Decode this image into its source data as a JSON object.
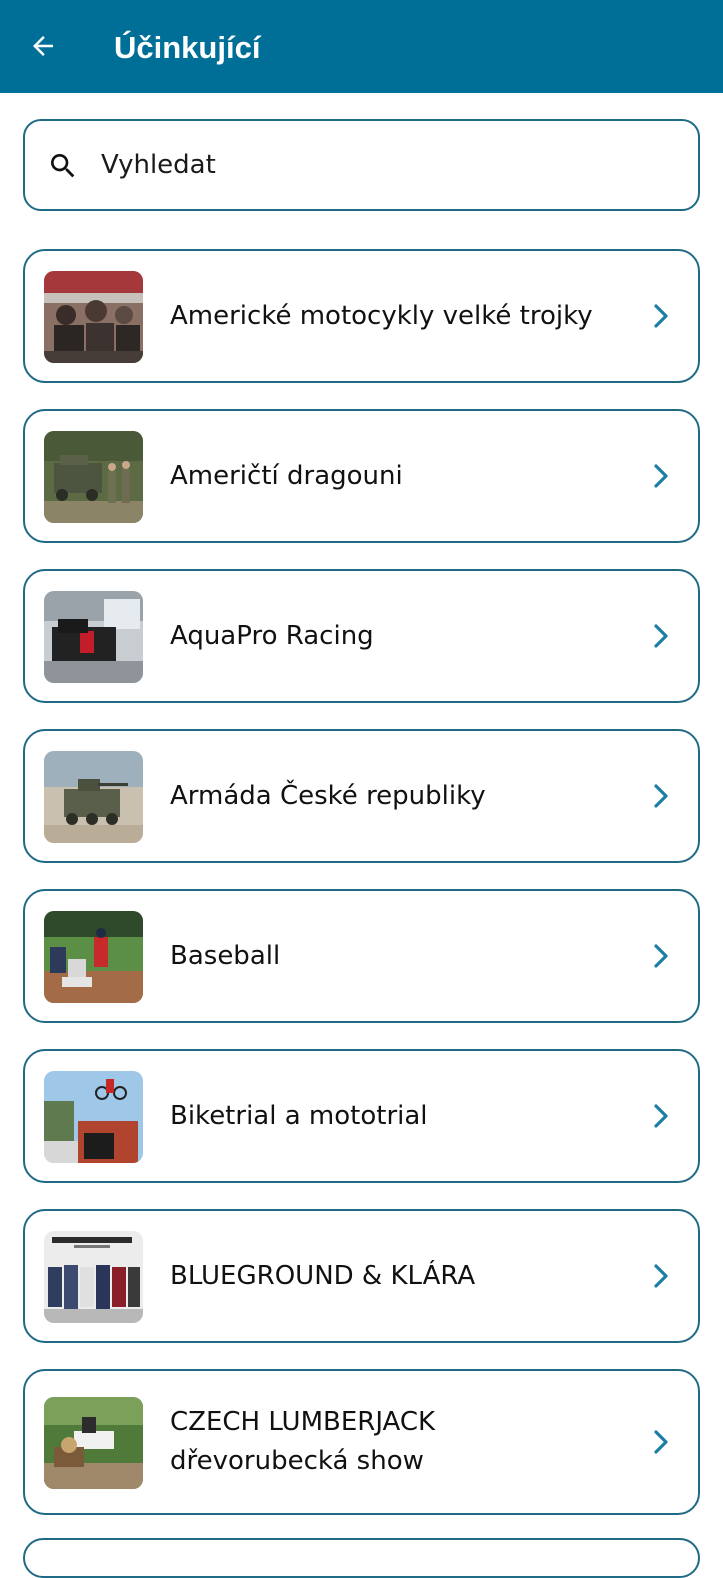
{
  "appbar": {
    "title": "Účinkující",
    "back_icon": "arrow-left-icon",
    "background": "#006f98"
  },
  "search": {
    "placeholder": "Vyhledat",
    "value": "",
    "icon": "search-icon"
  },
  "performers": [
    {
      "label": "Americké motocykly velké trojky",
      "thumb": "motorcycle-riders-photo"
    },
    {
      "label": "Američtí dragouni",
      "thumb": "military-vehicle-soldiers-photo"
    },
    {
      "label": "AquaPro Racing",
      "thumb": "racing-simulator-photo"
    },
    {
      "label": "Armáda České republiky",
      "thumb": "armored-vehicle-photo"
    },
    {
      "label": "Baseball",
      "thumb": "baseball-players-photo"
    },
    {
      "label": "Biketrial a mototrial",
      "thumb": "bike-jump-photo"
    },
    {
      "label": "BLUEGROUND & KLÁRA",
      "thumb": "band-photo"
    },
    {
      "label": "CZECH LUMBERJACK dřevorubecká show",
      "thumb": "lumberjack-show-photo"
    }
  ],
  "colors": {
    "accent": "#006f98",
    "border": "#1f6b86",
    "chevron": "#1b7ea6"
  }
}
